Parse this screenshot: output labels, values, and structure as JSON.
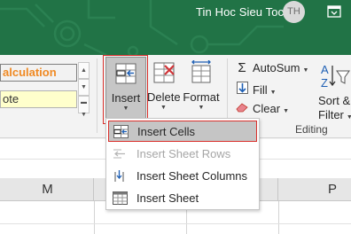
{
  "titlebar": {
    "user_name": "Tin Hoc Sieu Toc",
    "avatar_initials": "TH",
    "background_color": "#217346",
    "ribbon_display_icon": "ribbon-display-options-icon"
  },
  "styles_gallery": {
    "cells": [
      {
        "label": "alculation",
        "color": "#f08a24"
      },
      {
        "label": "ote",
        "color": "#ffffcc"
      }
    ],
    "scroll_icons": [
      "scroll-up-icon",
      "scroll-down-icon",
      "more-icon"
    ]
  },
  "cells_group": {
    "insert_label": "Insert",
    "delete_label": "Delete",
    "format_label": "Format"
  },
  "editing_group": {
    "autosum_label": "AutoSum",
    "fill_label": "Fill",
    "clear_label": "Clear",
    "sort_filter_line1": "Sort &",
    "sort_filter_line2": "Filter",
    "group_label": "Editing"
  },
  "insert_menu": {
    "items": [
      {
        "label": "Insert Cells",
        "enabled": true,
        "highlighted": true,
        "icon": "insert-cells-icon"
      },
      {
        "label": "Insert Sheet Rows",
        "enabled": false,
        "icon": "insert-rows-icon"
      },
      {
        "label": "Insert Sheet Columns",
        "enabled": true,
        "icon": "insert-columns-icon"
      },
      {
        "label": "Insert Sheet",
        "enabled": true,
        "icon": "insert-sheet-icon"
      }
    ]
  },
  "sheet": {
    "column_headers": [
      "M",
      "P"
    ]
  },
  "colors": {
    "accent_highlight": "#d9302c",
    "excel_green": "#217346"
  }
}
